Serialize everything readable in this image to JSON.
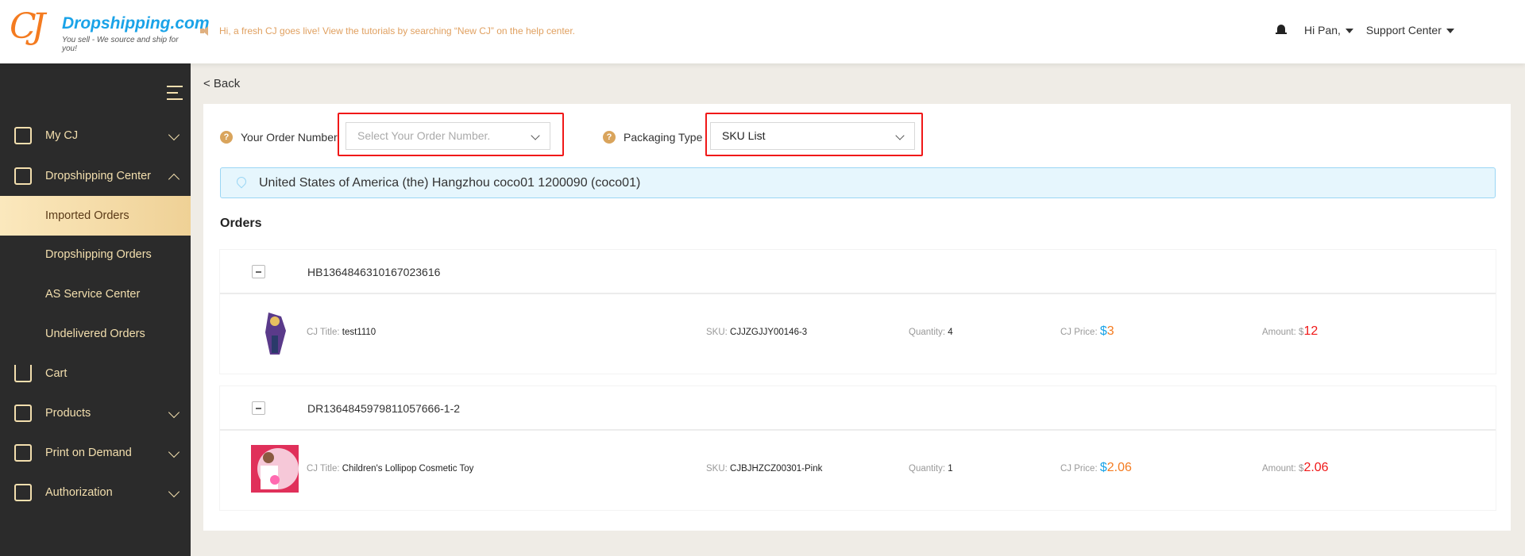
{
  "header": {
    "logo_mark": "CJ",
    "logo_brand": "Dropshipping.com",
    "logo_tagline": "You sell - We source and ship for you!",
    "notice": "Hi, a fresh CJ goes live! View the tutorials by searching “New CJ” on the help center.",
    "user": "Hi Pan,",
    "support": "Support Center"
  },
  "sidebar": {
    "items": [
      {
        "label": "My CJ",
        "icon": "monitor-icon"
      },
      {
        "label": "Dropshipping Center",
        "icon": "clipboard-icon"
      },
      {
        "label": "Imported Orders"
      },
      {
        "label": "Dropshipping Orders"
      },
      {
        "label": "AS Service Center"
      },
      {
        "label": "Undelivered Orders"
      },
      {
        "label": "Cart",
        "icon": "cart-icon"
      },
      {
        "label": "Products",
        "icon": "bag-icon"
      },
      {
        "label": "Print on Demand",
        "icon": "pod-icon"
      },
      {
        "label": "Authorization",
        "icon": "authorization-icon"
      }
    ]
  },
  "main": {
    "back": "< Back",
    "order_number_label": "Your Order Number",
    "order_number_placeholder": "Select Your Order Number.",
    "packaging_label": "Packaging Type",
    "packaging_value": "SKU List",
    "address": "United States of America (the) Hangzhou coco01 1200090 (coco01)",
    "orders_title": "Orders",
    "labels": {
      "title": "CJ Title:",
      "sku": "SKU:",
      "quantity": "Quantity:",
      "price": "CJ Price:",
      "amount": "Amount:",
      "currency": "$"
    },
    "orders": [
      {
        "id": "HB1364846310167023616",
        "title": "test1110",
        "sku": "CJJZGJJY00146-3",
        "quantity": "4",
        "price": "3",
        "amount": "12"
      },
      {
        "id": "DR1364845979811057666-1-2",
        "title": "Children's Lollipop Cosmetic Toy",
        "sku": "CJBJHZCZ00301-Pink",
        "quantity": "1",
        "price": "2.06",
        "amount": "2.06"
      }
    ]
  }
}
